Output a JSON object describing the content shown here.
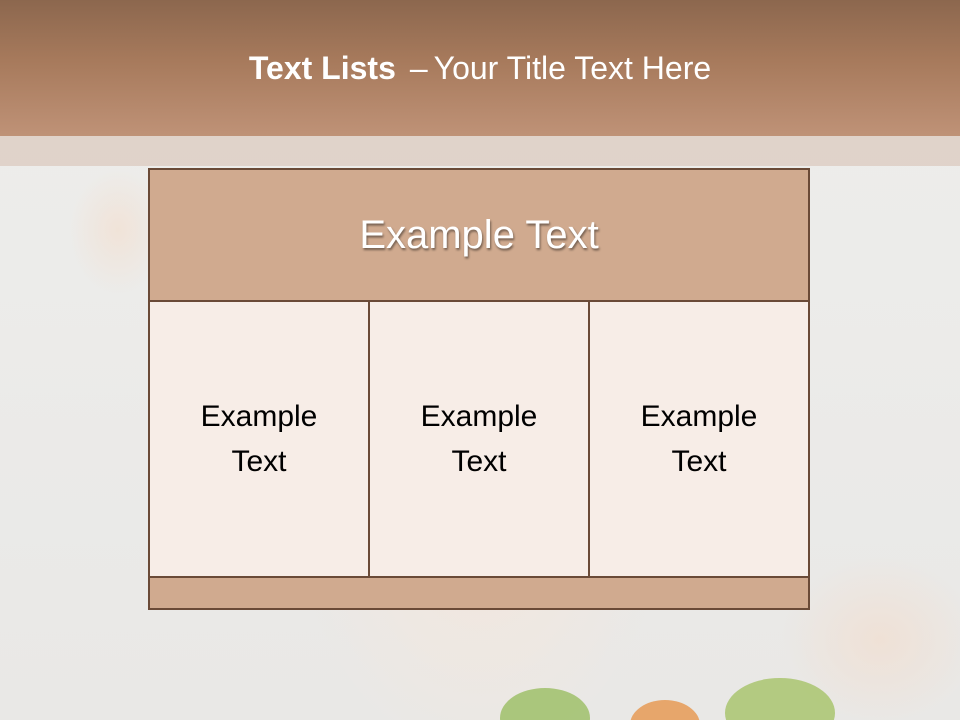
{
  "header": {
    "title_bold": "Text Lists",
    "title_separator": "–",
    "title_rest": "Your Title Text Here"
  },
  "table": {
    "heading": "Example Text",
    "cells": [
      "Example Text",
      "Example Text",
      "Example Text"
    ]
  },
  "colors": {
    "header_band": "#a77a5c",
    "table_header": "#d0aa8f",
    "table_border": "#6a4a37",
    "cell_fill": "#f7ede7"
  }
}
